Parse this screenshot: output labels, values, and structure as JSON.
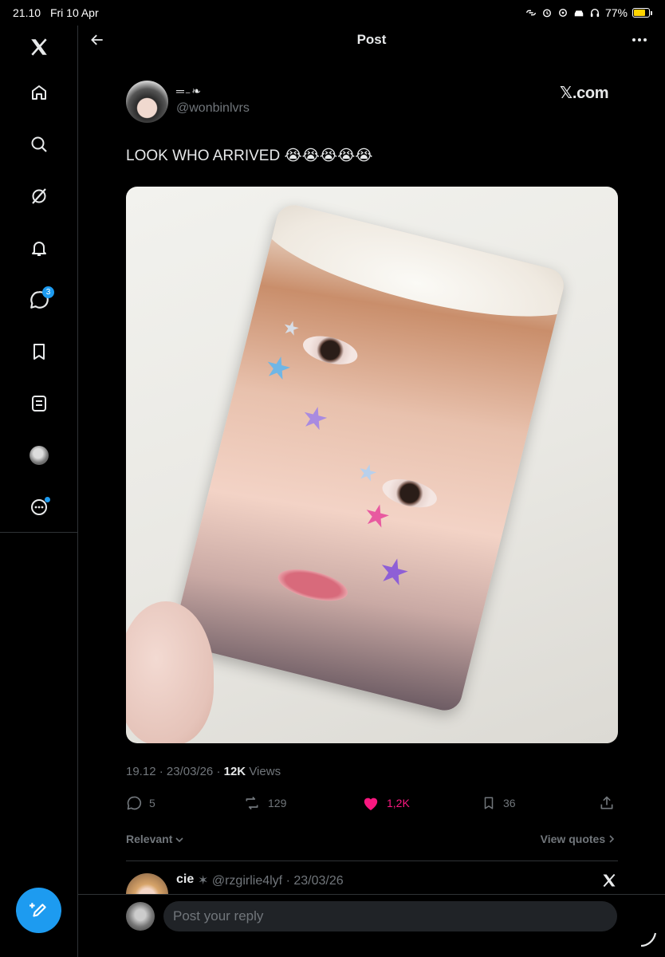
{
  "status_bar": {
    "time": "21.10",
    "date": "Fri 10 Apr",
    "battery": "77%",
    "battery_level": 0.77,
    "battery_color": "#ffd400"
  },
  "sidebar": {
    "items": [
      {
        "icon": "x-logo-icon"
      },
      {
        "icon": "home-icon"
      },
      {
        "icon": "search-icon"
      },
      {
        "icon": "grok-icon"
      },
      {
        "icon": "bell-icon"
      },
      {
        "icon": "messages-icon",
        "badge": "3"
      },
      {
        "icon": "bookmark-icon"
      },
      {
        "icon": "lists-icon"
      },
      {
        "icon": "profile-avatar"
      },
      {
        "icon": "more-circle-icon"
      }
    ],
    "compose_icon": "compose-icon",
    "accent": "#1d9bf0"
  },
  "header": {
    "title": "Post"
  },
  "post": {
    "display_name": "═₋❧",
    "handle": "@wonbinlvrs",
    "source": "𝕏.com",
    "text": "LOOK WHO ARRIVED 😭😭😭😭😭",
    "time": "19.12",
    "date": "23/03/26",
    "views_count": "12K",
    "views_label": " Views",
    "replies": "5",
    "reposts": "129",
    "likes": "1,2K",
    "bookmarks": "36",
    "like_color": "#f91880"
  },
  "replies_section": {
    "sort_label": "Relevant",
    "view_quotes": "View quotes",
    "first_reply": {
      "name": "cie",
      "badge": "✶",
      "handle": "@rzgirlie4lyf",
      "date": "23/03/26"
    }
  },
  "reply_bar": {
    "placeholder": "Post your reply"
  }
}
